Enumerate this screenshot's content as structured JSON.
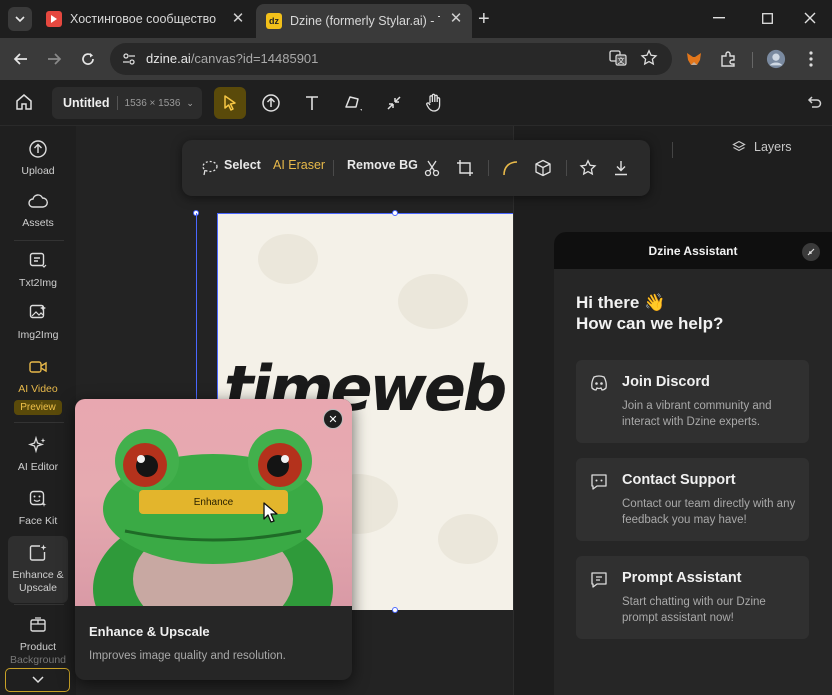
{
  "browser": {
    "tabs": [
      {
        "title": "Хостинговое сообщество «Tim",
        "favicon": "youtube-like-icon",
        "color": "#e5483f"
      },
      {
        "title": "Dzine (formerly Stylar.ai) - The f",
        "favicon": "dz",
        "color": "#f2c01a",
        "active": true
      }
    ],
    "url_host": "dzine.ai",
    "url_path": "/canvas?id=14485901"
  },
  "app": {
    "doc_title": "Untitled",
    "doc_size": "1536 × 1536",
    "accent": "#f6c744"
  },
  "rail": {
    "upload": "Upload",
    "assets": "Assets",
    "txt2img": "Txt2Img",
    "img2img": "Img2Img",
    "ai_video": "AI Video",
    "preview": "Preview",
    "ai_editor": "AI Editor",
    "face_kit": "Face Kit",
    "enhance_l1": "Enhance &",
    "enhance_l2": "Upscale",
    "product_l1": "Product",
    "product_l2": "Background"
  },
  "floatbar": {
    "select": "Select",
    "ai_eraser": "AI Eraser",
    "remove_bg": "Remove BG"
  },
  "canvas": {
    "wordmark": "timeweb"
  },
  "right_panel": {
    "layers": "Layers"
  },
  "assistant": {
    "title": "Dzine Assistant",
    "greeting_line1": "Hi there 👋",
    "greeting_line2": "How can we help?",
    "cards": [
      {
        "title": "Join Discord",
        "desc": "Join a vibrant community and interact with Dzine experts."
      },
      {
        "title": "Contact Support",
        "desc": "Contact our team directly with any feedback you may have!"
      },
      {
        "title": "Prompt Assistant",
        "desc": "Start chatting with our Dzine prompt assistant now!"
      }
    ]
  },
  "popup": {
    "button": "Enhance",
    "title": "Enhance & Upscale",
    "desc": "Improves image quality and resolution."
  }
}
